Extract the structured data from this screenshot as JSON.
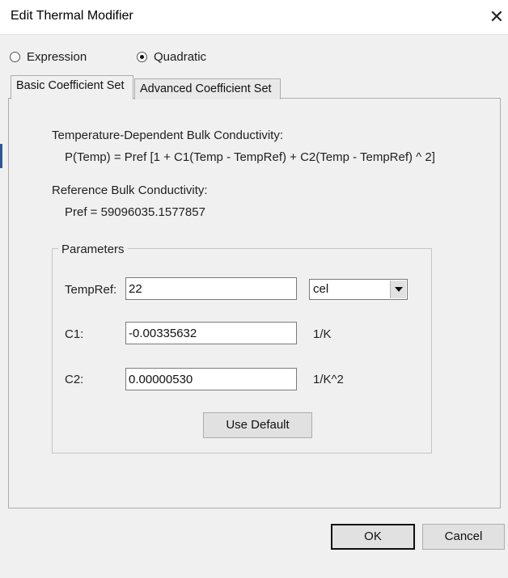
{
  "window": {
    "title": "Edit Thermal Modifier",
    "close_glyph": "✕"
  },
  "mode": {
    "expression_label": "Expression",
    "quadratic_label": "Quadratic",
    "selected": "Quadratic"
  },
  "tabs": [
    {
      "label": "Basic Coefficient Set",
      "active": true
    },
    {
      "label": "Advanced Coefficient Set",
      "active": false
    }
  ],
  "formula": {
    "heading": "Temperature-Dependent Bulk Conductivity:",
    "equation": "P(Temp) = Pref [1 + C1(Temp - TempRef) + C2(Temp - TempRef) ^ 2]",
    "ref_heading": "Reference Bulk Conductivity:",
    "ref_value": "Pref = 59096035.1577857"
  },
  "parameters": {
    "group_label": "Parameters",
    "tempref": {
      "label": "TempRef:",
      "value": "22",
      "unit_selected": "cel"
    },
    "c1": {
      "label": "C1:",
      "value": "-0.00335632",
      "unit": "1/K"
    },
    "c2": {
      "label": "C2:",
      "value": "0.00000530",
      "unit": "1/K^2"
    },
    "use_default_label": "Use Default"
  },
  "footer": {
    "ok_label": "OK",
    "cancel_label": "Cancel"
  },
  "icons": {
    "close": "close-icon",
    "dropdown": "chevron-down-icon"
  },
  "colors": {
    "dialog_bg": "#f0f0f0",
    "titlebar_bg": "#ffffff",
    "button_bg": "#e1e1e1",
    "border": "#adadad"
  }
}
